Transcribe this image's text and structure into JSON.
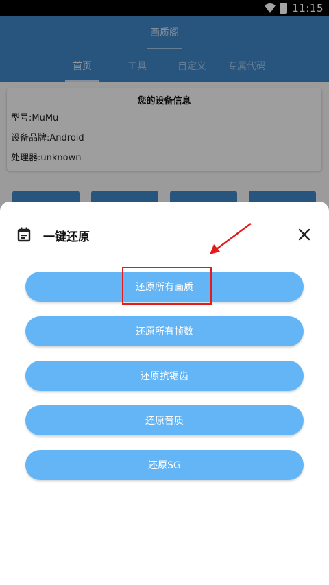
{
  "status_bar": {
    "time": "11:15"
  },
  "app": {
    "title": "画质阁"
  },
  "tabs": [
    {
      "label": "首页",
      "active": true
    },
    {
      "label": "工具",
      "active": false
    },
    {
      "label": "自定义",
      "active": false
    },
    {
      "label": "专属代码",
      "active": false
    }
  ],
  "device_info": {
    "heading": "您的设备信息",
    "model": "型号:MuMu",
    "brand": "设备品牌:Android",
    "processor": "处理器:unknown"
  },
  "sheet": {
    "title": "一键还原",
    "buttons": [
      {
        "label": "还原所有画质"
      },
      {
        "label": "还原所有帧数"
      },
      {
        "label": "还原抗锯齿"
      },
      {
        "label": "还原音质"
      },
      {
        "label": "还原SG"
      }
    ]
  },
  "icons": {
    "sheet_icon": "calendar-icon",
    "close": "close-icon",
    "wifi": "wifi-icon",
    "battery": "battery-icon"
  },
  "colors": {
    "primary": "#3f85c5",
    "button": "#64b5f6",
    "annotation": "#e41b1b"
  }
}
